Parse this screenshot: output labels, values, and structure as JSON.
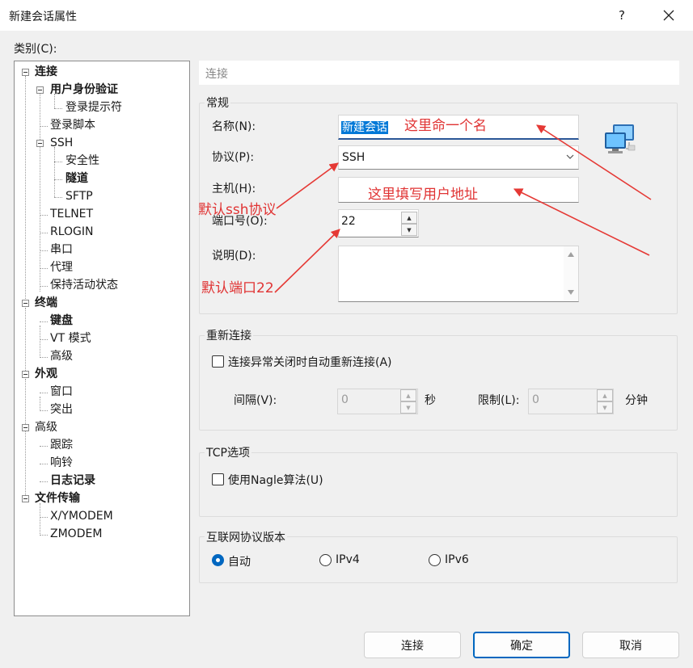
{
  "window": {
    "title": "新建会话属性",
    "help": "?"
  },
  "category_label": "类别(C):",
  "tree": [
    {
      "label": "连接",
      "bold": true
    },
    {
      "label": "用户身份验证",
      "bold": true
    },
    {
      "label": "登录提示符",
      "bold": false
    },
    {
      "label": "登录脚本",
      "bold": false
    },
    {
      "label": "SSH",
      "bold": false
    },
    {
      "label": "安全性",
      "bold": false
    },
    {
      "label": "隧道",
      "bold": true
    },
    {
      "label": "SFTP",
      "bold": false
    },
    {
      "label": "TELNET",
      "bold": false
    },
    {
      "label": "RLOGIN",
      "bold": false
    },
    {
      "label": "串口",
      "bold": false
    },
    {
      "label": "代理",
      "bold": false
    },
    {
      "label": "保持活动状态",
      "bold": false
    },
    {
      "label": "终端",
      "bold": true
    },
    {
      "label": "键盘",
      "bold": true
    },
    {
      "label": "VT 模式",
      "bold": false
    },
    {
      "label": "高级",
      "bold": false
    },
    {
      "label": "外观",
      "bold": true
    },
    {
      "label": "窗口",
      "bold": false
    },
    {
      "label": "突出",
      "bold": false
    },
    {
      "label": "高级",
      "bold": false
    },
    {
      "label": "跟踪",
      "bold": false
    },
    {
      "label": "响铃",
      "bold": false
    },
    {
      "label": "日志记录",
      "bold": true
    },
    {
      "label": "文件传输",
      "bold": true
    },
    {
      "label": "X/YMODEM",
      "bold": false
    },
    {
      "label": "ZMODEM",
      "bold": false
    }
  ],
  "panel": {
    "header": "连接",
    "general": {
      "title": "常规",
      "name_label": "名称(N):",
      "name_value": "新建会话",
      "protocol_label": "协议(P):",
      "protocol_value": "SSH",
      "host_label": "主机(H):",
      "host_value": "",
      "port_label": "端口号(O):",
      "port_value": "22",
      "desc_label": "说明(D):",
      "desc_value": ""
    },
    "reconnect": {
      "title": "重新连接",
      "auto_label": "连接异常关闭时自动重新连接(A)",
      "auto_checked": false,
      "interval_label": "间隔(V):",
      "interval_value": "0",
      "interval_unit": "秒",
      "limit_label": "限制(L):",
      "limit_value": "0",
      "limit_unit": "分钟"
    },
    "tcp": {
      "title": "TCP选项",
      "nagle_label": "使用Nagle算法(U)",
      "nagle_checked": false
    },
    "ip": {
      "title": "互联网协议版本",
      "options": [
        "自动",
        "IPv4",
        "IPv6"
      ],
      "selected": "自动"
    }
  },
  "buttons": {
    "connect": "连接",
    "ok": "确定",
    "cancel": "取消"
  },
  "annotations": {
    "name_hint": "这里命一个名",
    "host_hint": "这里填写用户地址",
    "protocol_hint": "默认ssh协议",
    "port_hint": "默认端口22",
    "color": "#e53935"
  }
}
